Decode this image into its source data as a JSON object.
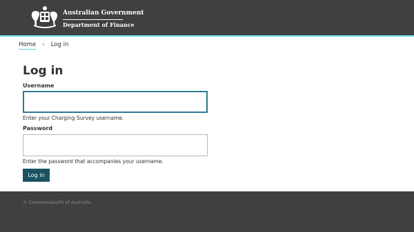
{
  "header": {
    "government": "Australian Government",
    "department": "Department of Finance",
    "colors": {
      "background": "#3f4042",
      "accent_rule": "#5ecbd3"
    },
    "logo_icon": "commonwealth-coat-of-arms-icon"
  },
  "breadcrumb": {
    "items": [
      {
        "label": "Home"
      },
      {
        "label": "Log in"
      }
    ],
    "separator": "›"
  },
  "form": {
    "title": "Log in",
    "username": {
      "label": "Username",
      "value": "",
      "help": "Enter your Charging Survey username."
    },
    "password": {
      "label": "Password",
      "value": "",
      "help": "Enter the password that accompanies your username."
    },
    "submit_label": "Log in",
    "colors": {
      "button": "#1a5261",
      "focus_border": "#2b7a8e"
    }
  },
  "footer": {
    "copyright": "© Commonwealth of Australia"
  }
}
